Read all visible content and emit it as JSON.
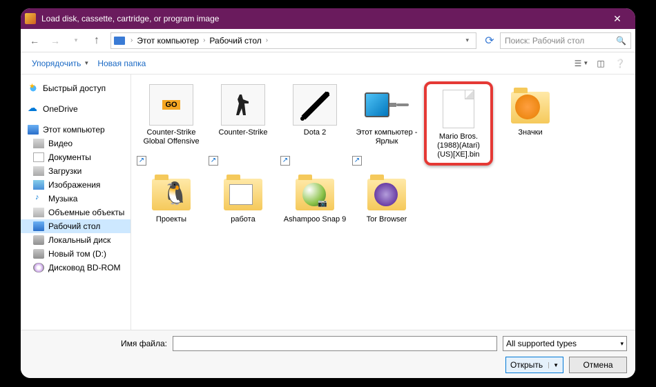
{
  "window": {
    "title": "Load disk, cassette, cartridge, or program image"
  },
  "nav": {
    "breadcrumbs": [
      "Этот компьютер",
      "Рабочий стол"
    ],
    "search_placeholder": "Поиск: Рабочий стол"
  },
  "toolbar": {
    "organize": "Упорядочить",
    "newfolder": "Новая папка"
  },
  "sidebar": {
    "quick": "Быстрый доступ",
    "onedrive": "OneDrive",
    "thispc": "Этот компьютер",
    "items": [
      {
        "label": "Видео"
      },
      {
        "label": "Документы"
      },
      {
        "label": "Загрузки"
      },
      {
        "label": "Изображения"
      },
      {
        "label": "Музыка"
      },
      {
        "label": "Объемные объекты"
      },
      {
        "label": "Рабочий стол"
      },
      {
        "label": "Локальный диск"
      },
      {
        "label": "Новый том (D:)"
      },
      {
        "label": "Дисковод BD-ROM"
      }
    ]
  },
  "files": {
    "r1": [
      {
        "label": "Counter-Strike Global Offensive"
      },
      {
        "label": "Counter-Strike"
      },
      {
        "label": "Dota 2"
      },
      {
        "label": "Этот компьютер - Ярлык"
      },
      {
        "label": "Mario Bros.(1988)(Atari)(US)[XE].bin"
      },
      {
        "label": "Значки"
      },
      {
        "label": "Проекты"
      }
    ],
    "r2": [
      {
        "label": "работа"
      },
      {
        "label": "Ashampoo Snap 9"
      },
      {
        "label": "Tor Browser"
      }
    ]
  },
  "footer": {
    "filename_label": "Имя файла:",
    "filename_value": "",
    "filter": "All supported types",
    "open": "Открыть",
    "cancel": "Отмена"
  },
  "csgo_text": "GO"
}
